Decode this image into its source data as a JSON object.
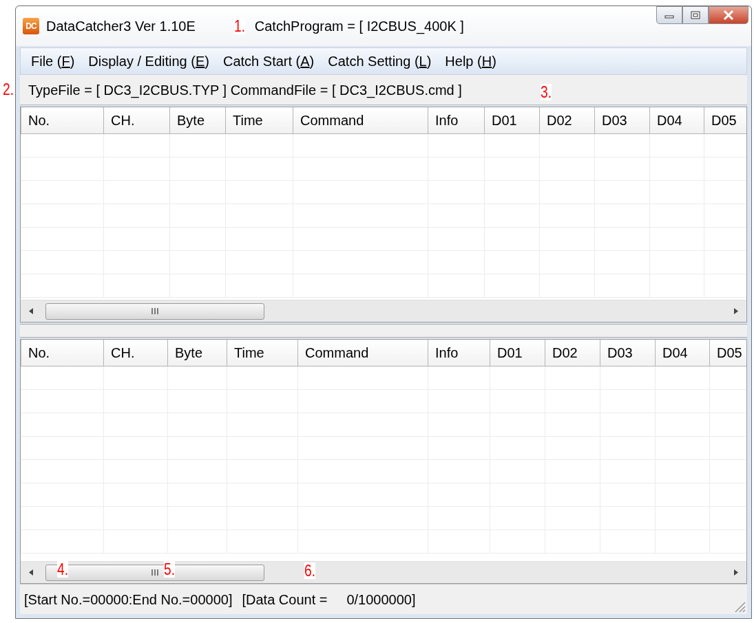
{
  "window": {
    "title": "DataCatcher3 Ver 1.10E",
    "subtitle": "CatchProgram = [ I2CBUS_400K ]",
    "logo": "DC"
  },
  "menu": [
    {
      "before": "File (",
      "key": "F",
      "after": ")"
    },
    {
      "before": "Display / Editing (",
      "key": "E",
      "after": ")"
    },
    {
      "before": "Catch Start (",
      "key": "A",
      "after": ")"
    },
    {
      "before": "Catch Setting (",
      "key": "L",
      "after": ")"
    },
    {
      "before": "Help (",
      "key": "H",
      "after": ")"
    }
  ],
  "file_info": "TypeFile = [ DC3_I2CBUS.TYP ] CommandFile = [ DC3_I2CBUS.cmd ]",
  "tables": [
    {
      "columns": [
        "No.",
        "CH.",
        "Byte",
        "Time",
        "Command",
        "Info",
        "D01",
        "D02",
        "D03",
        "D04",
        "D05"
      ]
    },
    {
      "columns": [
        "No.",
        "CH.",
        "Byte",
        "Time",
        "Command",
        "Info",
        "D01",
        "D02",
        "D03",
        "D04",
        "D05"
      ]
    }
  ],
  "status_bar": {
    "range": "[Start No.=00000:End No.=00000]",
    "count_label": "[Data Count =",
    "count": "0/1000000]"
  },
  "callouts": [
    "1.",
    "2.",
    "3.",
    "4.",
    "5.",
    "6."
  ]
}
